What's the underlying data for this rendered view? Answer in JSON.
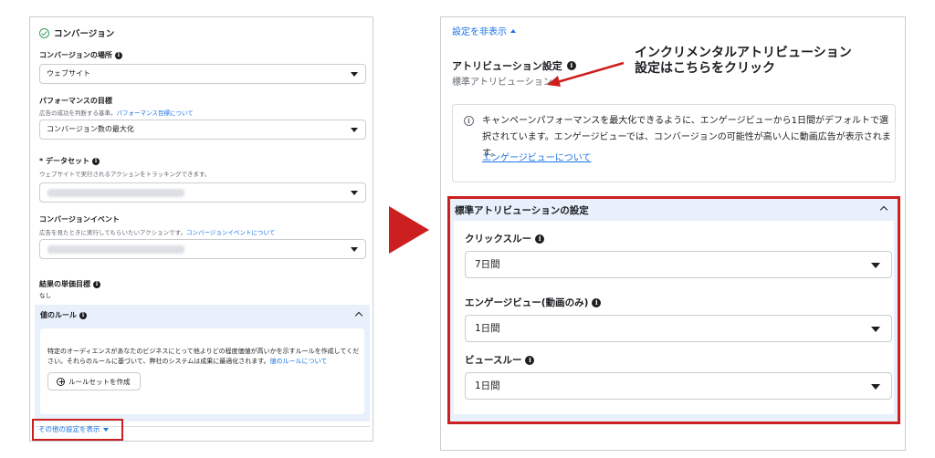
{
  "left": {
    "header": "コンバージョン",
    "conversion_location": {
      "label": "コンバージョンの場所",
      "value": "ウェブサイト"
    },
    "performance_goal": {
      "label": "パフォーマンスの目標",
      "help": "広告の成功を判断する基準。",
      "help_link": "パフォーマンス目標について",
      "value": "コンバージョン数の最大化"
    },
    "dataset": {
      "label": "* データセット",
      "help": "ウェブサイトで実行されるアクションをトラッキングできます。"
    },
    "conversion_event": {
      "label": "コンバージョンイベント",
      "help": "広告を見たときに実行してもらいたいアクションです。",
      "help_link": "コンバージョンイベントについて"
    },
    "cost_per_result": {
      "label": "結果の単価目標",
      "value": "なし"
    },
    "value_rules": {
      "title": "値のルール",
      "description": "特定のオーディエンスがあなたのビジネスにとって他よりどの程度価値が高いかを示すルールを作成してください。それらのルールに基づいて、弊社のシステムは成果に最適化されます。",
      "link": "値のルールについて",
      "button": "ルールセットを作成"
    },
    "more_settings": "その他の設定を表示"
  },
  "right": {
    "hide_settings": "設定を非表示",
    "attribution_label": "アトリビューション設定",
    "attribution_value": "標準アトリビューション",
    "annotation_line1": "インクリメンタルアトリビューション",
    "annotation_line2": "設定はこちらをクリック",
    "notice_text": "キャンペーンパフォーマンスを最大化できるように、エンゲージビューから1日間がデフォルトで選択されています。エンゲージビューでは、コンバージョンの可能性が高い人に動画広告が表示されます。",
    "notice_link": "エンゲージビューについて",
    "std_section": {
      "title": "標準アトリビューションの設定",
      "fields": [
        {
          "label": "クリックスルー",
          "value": "7日間"
        },
        {
          "label": "エンゲージビュー(動画のみ)",
          "value": "1日間"
        },
        {
          "label": "ビュースルー",
          "value": "1日間"
        }
      ]
    }
  },
  "colors": {
    "accent_red": "#cc1f1f",
    "link_blue": "#1b74e4",
    "section_bg": "#e7f0fb",
    "check_green": "#3a9c5d"
  }
}
